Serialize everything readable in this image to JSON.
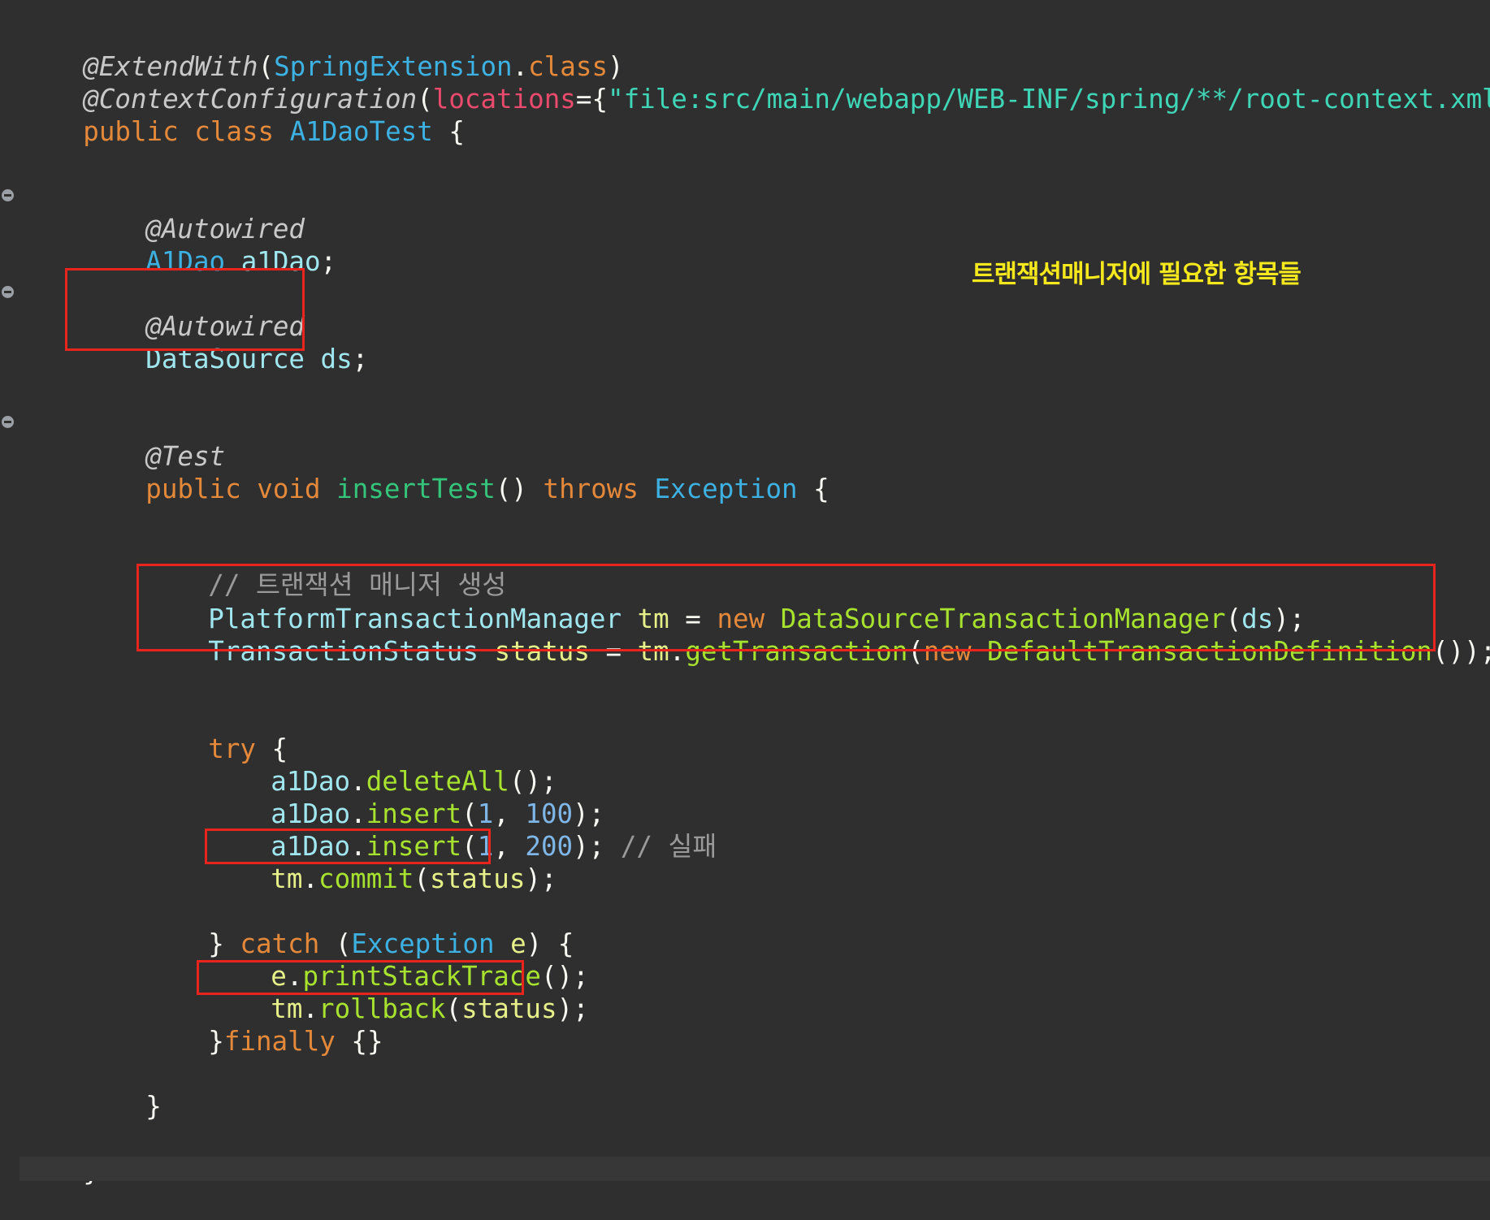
{
  "code": {
    "l1": [
      "@ExtendWith",
      "(",
      "SpringExtension",
      ".",
      "class",
      ")"
    ],
    "l2": [
      "@ContextConfiguration",
      "(",
      "locations",
      "={",
      "\"file:src/main/webapp/WEB-INF/spring/**/root-context.xml\"",
      "})"
    ],
    "l3": [
      "public",
      " ",
      "class",
      " ",
      "A1DaoTest",
      " {"
    ],
    "l4": [
      "@Autowired"
    ],
    "l5": [
      "A1Dao",
      " ",
      "a1Dao",
      ";"
    ],
    "l6": [
      "@Autowired"
    ],
    "l7": [
      "DataSource",
      " ",
      "ds",
      ";"
    ],
    "l8": [
      "@Test"
    ],
    "l9": [
      "public",
      " ",
      "void",
      " ",
      "insertTest",
      "() ",
      "throws",
      " ",
      "Exception",
      " {"
    ],
    "l10": [
      "// 트랜잭션 매니저 생성"
    ],
    "l11": [
      "PlatformTransactionManager",
      " ",
      "tm",
      " = ",
      "new",
      " ",
      "DataSourceTransactionManager",
      "(",
      "ds",
      ");"
    ],
    "l12": [
      "TransactionStatus",
      " ",
      "status",
      " = ",
      "tm",
      ".",
      "getTransaction",
      "(",
      "new",
      " ",
      "DefaultTransactionDefinition",
      "());"
    ],
    "l13": [
      "try",
      " {"
    ],
    "l14": [
      "a1Dao",
      ".",
      "deleteAll",
      "();"
    ],
    "l15": [
      "a1Dao",
      ".",
      "insert",
      "(",
      "1",
      ", ",
      "100",
      ");"
    ],
    "l16": [
      "a1Dao",
      ".",
      "insert",
      "(",
      "1",
      ", ",
      "200",
      "); ",
      "// 실패"
    ],
    "l17": [
      "tm",
      ".",
      "commit",
      "(",
      "status",
      ");"
    ],
    "l18": [
      "} ",
      "catch",
      " (",
      "Exception",
      " ",
      "e",
      ") {"
    ],
    "l19": [
      "e",
      ".",
      "printStackTrace",
      "();"
    ],
    "l20": [
      "tm",
      ".",
      "rollback",
      "(",
      "status",
      ");"
    ],
    "l21": [
      "}",
      "finally",
      " {}"
    ],
    "l22": [
      "}"
    ],
    "l23": [
      "}"
    ]
  },
  "annotation_note": "트랜잭션매니저에 필요한 항목들",
  "colors": {
    "background": "#2f2f2f",
    "annotation": "#c9c9c9",
    "keyword": "#e4883a",
    "type": "#3cb1e2",
    "type_light": "#9fe6ef",
    "field": "#e6f089",
    "method": "#a6e22e",
    "string": "#3fd6b8",
    "number": "#7eb6e8",
    "comment": "#9a9a9a",
    "highlight_box": "#e8241c",
    "note_text": "#f5e81c"
  }
}
